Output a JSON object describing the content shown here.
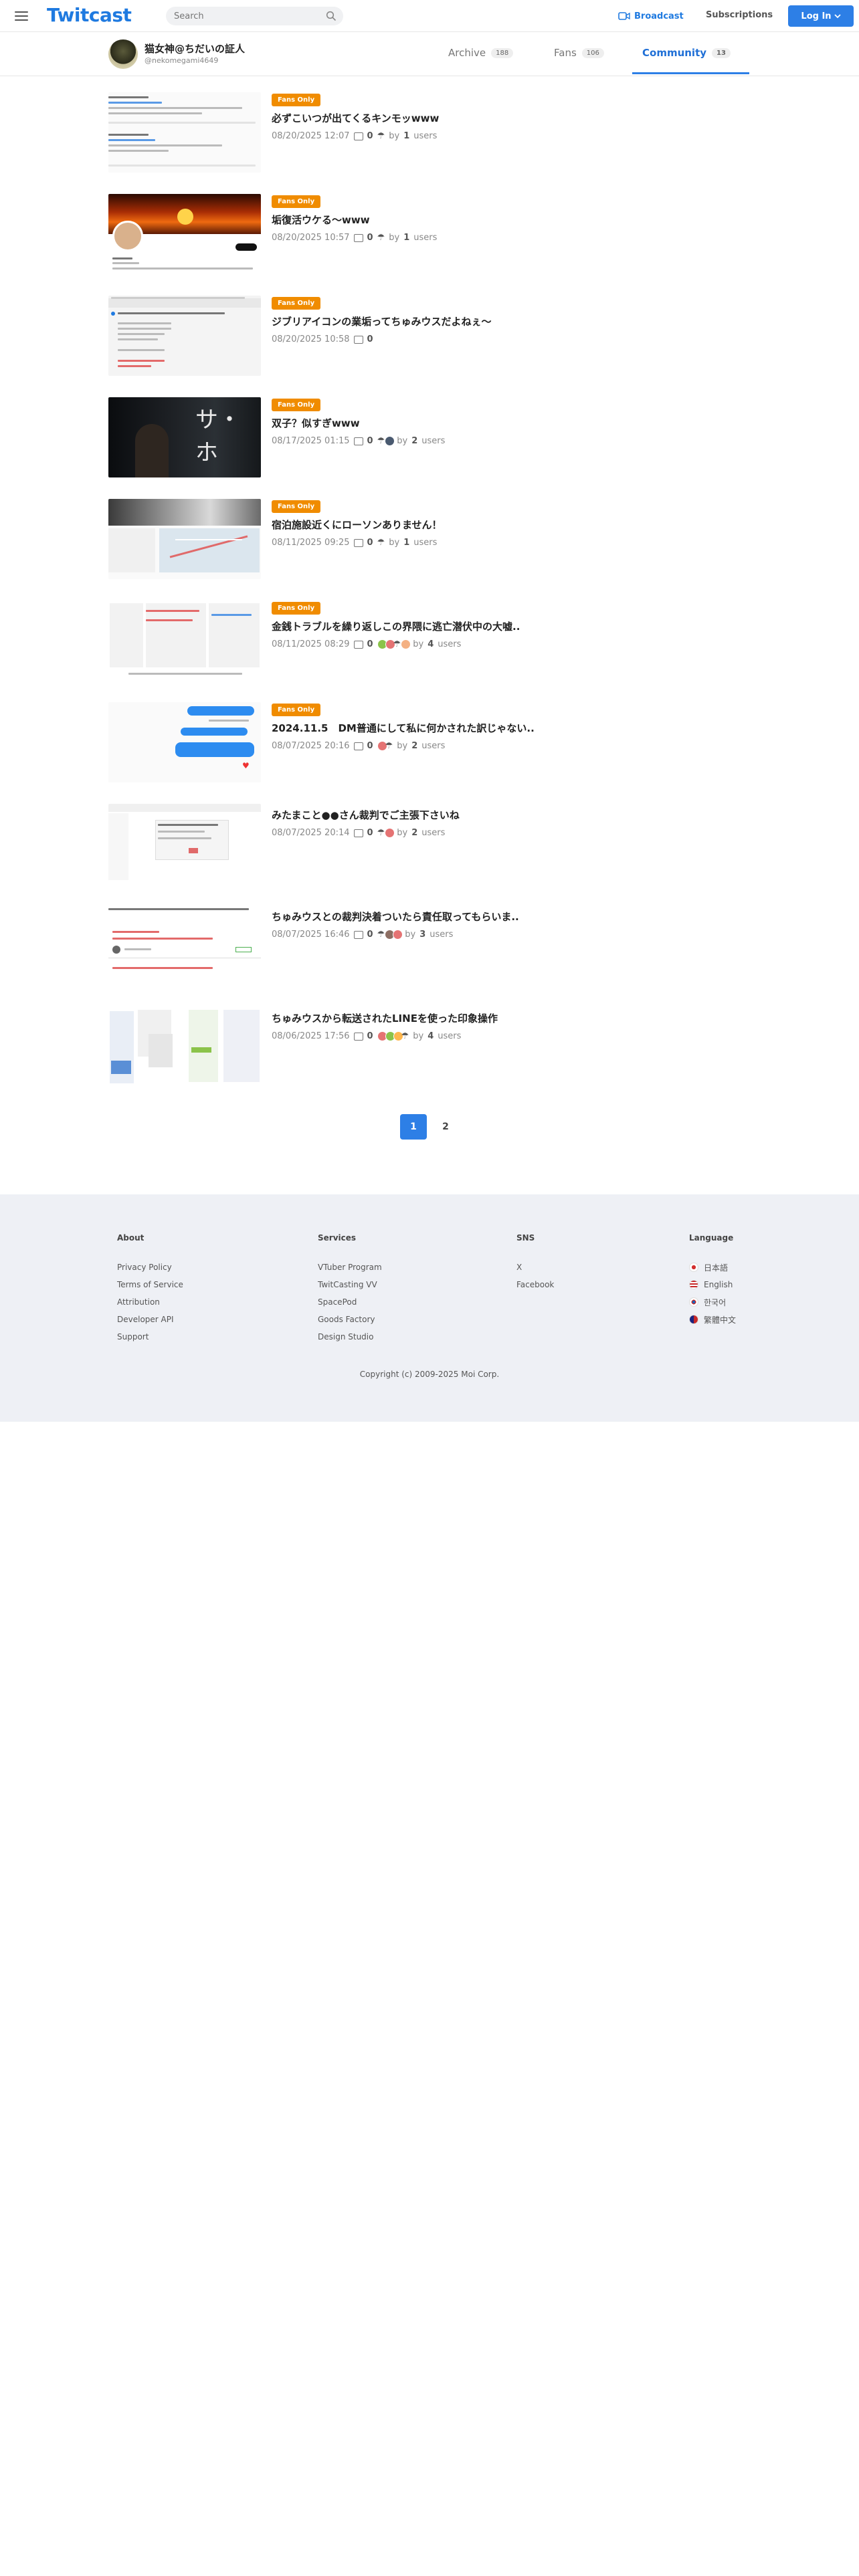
{
  "header": {
    "logo": "Twitcast",
    "search_placeholder": "Search",
    "broadcast": "Broadcast",
    "subscriptions": "Subscriptions",
    "login": "Log In"
  },
  "profile": {
    "name": "猫女神@ちだいの証人",
    "handle": "@nekomegami4649",
    "tabs": [
      {
        "label": "Archive",
        "count": "188"
      },
      {
        "label": "Fans",
        "count": "106"
      },
      {
        "label": "Community",
        "count": "13"
      }
    ]
  },
  "posts": [
    {
      "badge": "Fans Only",
      "title": "必ずこいつが出てくるキンモッwww",
      "date": "08/20/2025 12:07",
      "comments": "0",
      "by": "by",
      "users": "1",
      "users_label": "users"
    },
    {
      "badge": "Fans Only",
      "title": "垢復活ウケる〜www",
      "date": "08/20/2025 10:57",
      "comments": "0",
      "by": "by",
      "users": "1",
      "users_label": "users"
    },
    {
      "badge": "Fans Only",
      "title": "ジブリアイコンの業垢ってちゅみウスだよねぇ〜",
      "date": "08/20/2025 10:58",
      "comments": "0"
    },
    {
      "badge": "Fans Only",
      "title": "双子？似すぎwww",
      "date": "08/17/2025 01:15",
      "comments": "0",
      "by": "by",
      "users": "2",
      "users_label": "users"
    },
    {
      "badge": "Fans Only",
      "title": "宿泊施設近くにローソンありません！",
      "date": "08/11/2025 09:25",
      "comments": "0",
      "by": "by",
      "users": "1",
      "users_label": "users"
    },
    {
      "badge": "Fans Only",
      "title": "金銭トラブルを繰り返しこの界隈に逃亡潜伏中の大嘘..",
      "date": "08/11/2025 08:29",
      "comments": "0",
      "by": "by",
      "users": "4",
      "users_label": "users"
    },
    {
      "badge": "Fans Only",
      "title": "2024.11.5　DM普通にして私に何かされた訳じゃない..",
      "date": "08/07/2025 20:16",
      "comments": "0",
      "by": "by",
      "users": "2",
      "users_label": "users"
    },
    {
      "badge": "",
      "title": "みたまこと●●さん裁判でご主張下さいね",
      "date": "08/07/2025 20:14",
      "comments": "0",
      "by": "by",
      "users": "2",
      "users_label": "users"
    },
    {
      "badge": "",
      "title": "ちゅみウスとの裁判決着ついたら責任取ってもらいま..",
      "date": "08/07/2025 16:46",
      "comments": "0",
      "by": "by",
      "users": "3",
      "users_label": "users"
    },
    {
      "badge": "",
      "title": "ちゅみウスから転送されたLINEを使った印象操作",
      "date": "08/06/2025 17:56",
      "comments": "0",
      "by": "by",
      "users": "4",
      "users_label": "users"
    }
  ],
  "pagination": {
    "pages": [
      "1",
      "2"
    ],
    "current": "1"
  },
  "footer": {
    "about": {
      "heading": "About",
      "links": [
        "Privacy Policy",
        "Terms of Service",
        "Attribution",
        "Developer API",
        "Support"
      ]
    },
    "services": {
      "heading": "Services",
      "links": [
        "VTuber Program",
        "TwitCasting VV",
        "SpacePod",
        "Goods Factory",
        "Design Studio"
      ]
    },
    "sns": {
      "heading": "SNS",
      "links": [
        "X",
        "Facebook"
      ]
    },
    "language": {
      "heading": "Language",
      "links": [
        "日本語",
        "English",
        "한국어",
        "繁體中文"
      ]
    },
    "copyright": "Copyright (c) 2009-2025 Moi Corp."
  },
  "colors": {
    "accent": "#2d7fe6",
    "badge": "#f08c00",
    "footer_bg": "#eef0f5"
  }
}
